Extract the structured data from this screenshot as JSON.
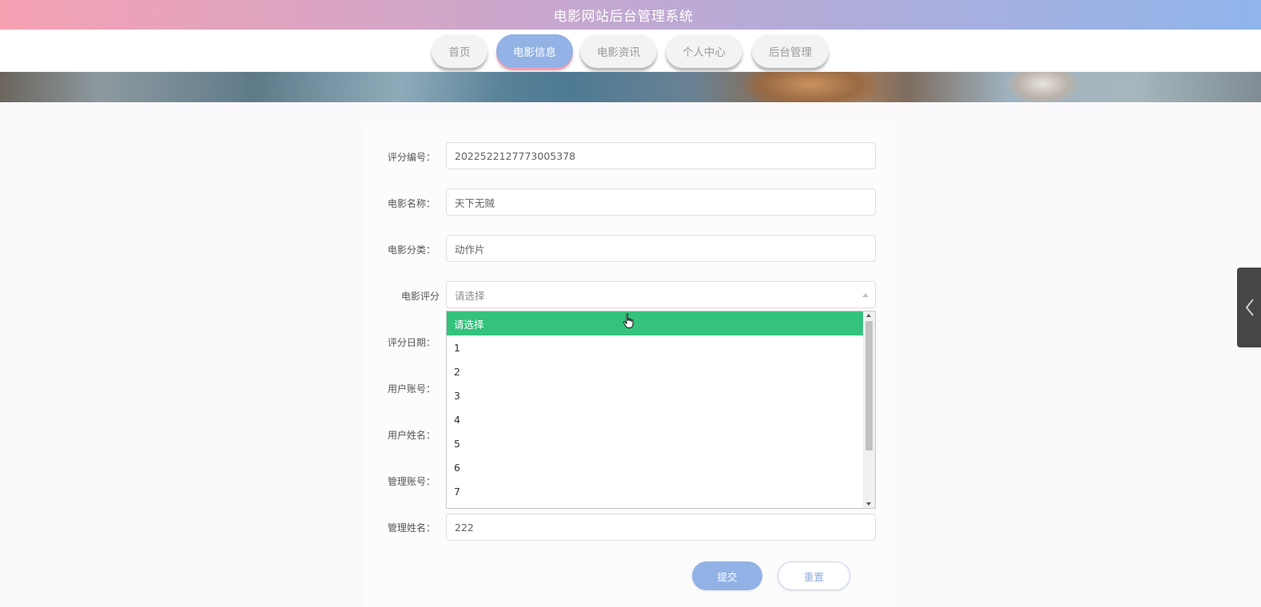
{
  "header": {
    "title": "电影网站后台管理系统"
  },
  "nav": {
    "items": [
      {
        "label": "首页"
      },
      {
        "label": "电影信息"
      },
      {
        "label": "电影资讯"
      },
      {
        "label": "个人中心"
      },
      {
        "label": "后台管理"
      }
    ],
    "active_index": 1
  },
  "form": {
    "rating_no": {
      "label": "评分编号：",
      "value": "2022522127773005378"
    },
    "movie_name": {
      "label": "电影名称：",
      "value": "天下无贼"
    },
    "movie_category": {
      "label": "电影分类：",
      "value": "动作片"
    },
    "movie_rating": {
      "label": "电影评分",
      "placeholder": "请选择"
    },
    "rating_date": {
      "label": "评分日期："
    },
    "user_account": {
      "label": "用户账号："
    },
    "user_name": {
      "label": "用户姓名："
    },
    "admin_account": {
      "label": "管理账号："
    },
    "admin_name": {
      "label": "管理姓名：",
      "value": "222"
    }
  },
  "dropdown": {
    "options": [
      "请选择",
      "1",
      "2",
      "3",
      "4",
      "5",
      "6",
      "7"
    ],
    "selected_index": 0
  },
  "buttons": {
    "submit": "提交",
    "reset": "重置"
  },
  "icons": {
    "side_tab": "chevron-left-icon",
    "cursor": "hand-pointer-icon"
  },
  "colors": {
    "accent_blue": "#92b2e6",
    "selected_green": "#34c27c",
    "header_start": "#f6a1b2",
    "header_end": "#8fb5eb"
  }
}
